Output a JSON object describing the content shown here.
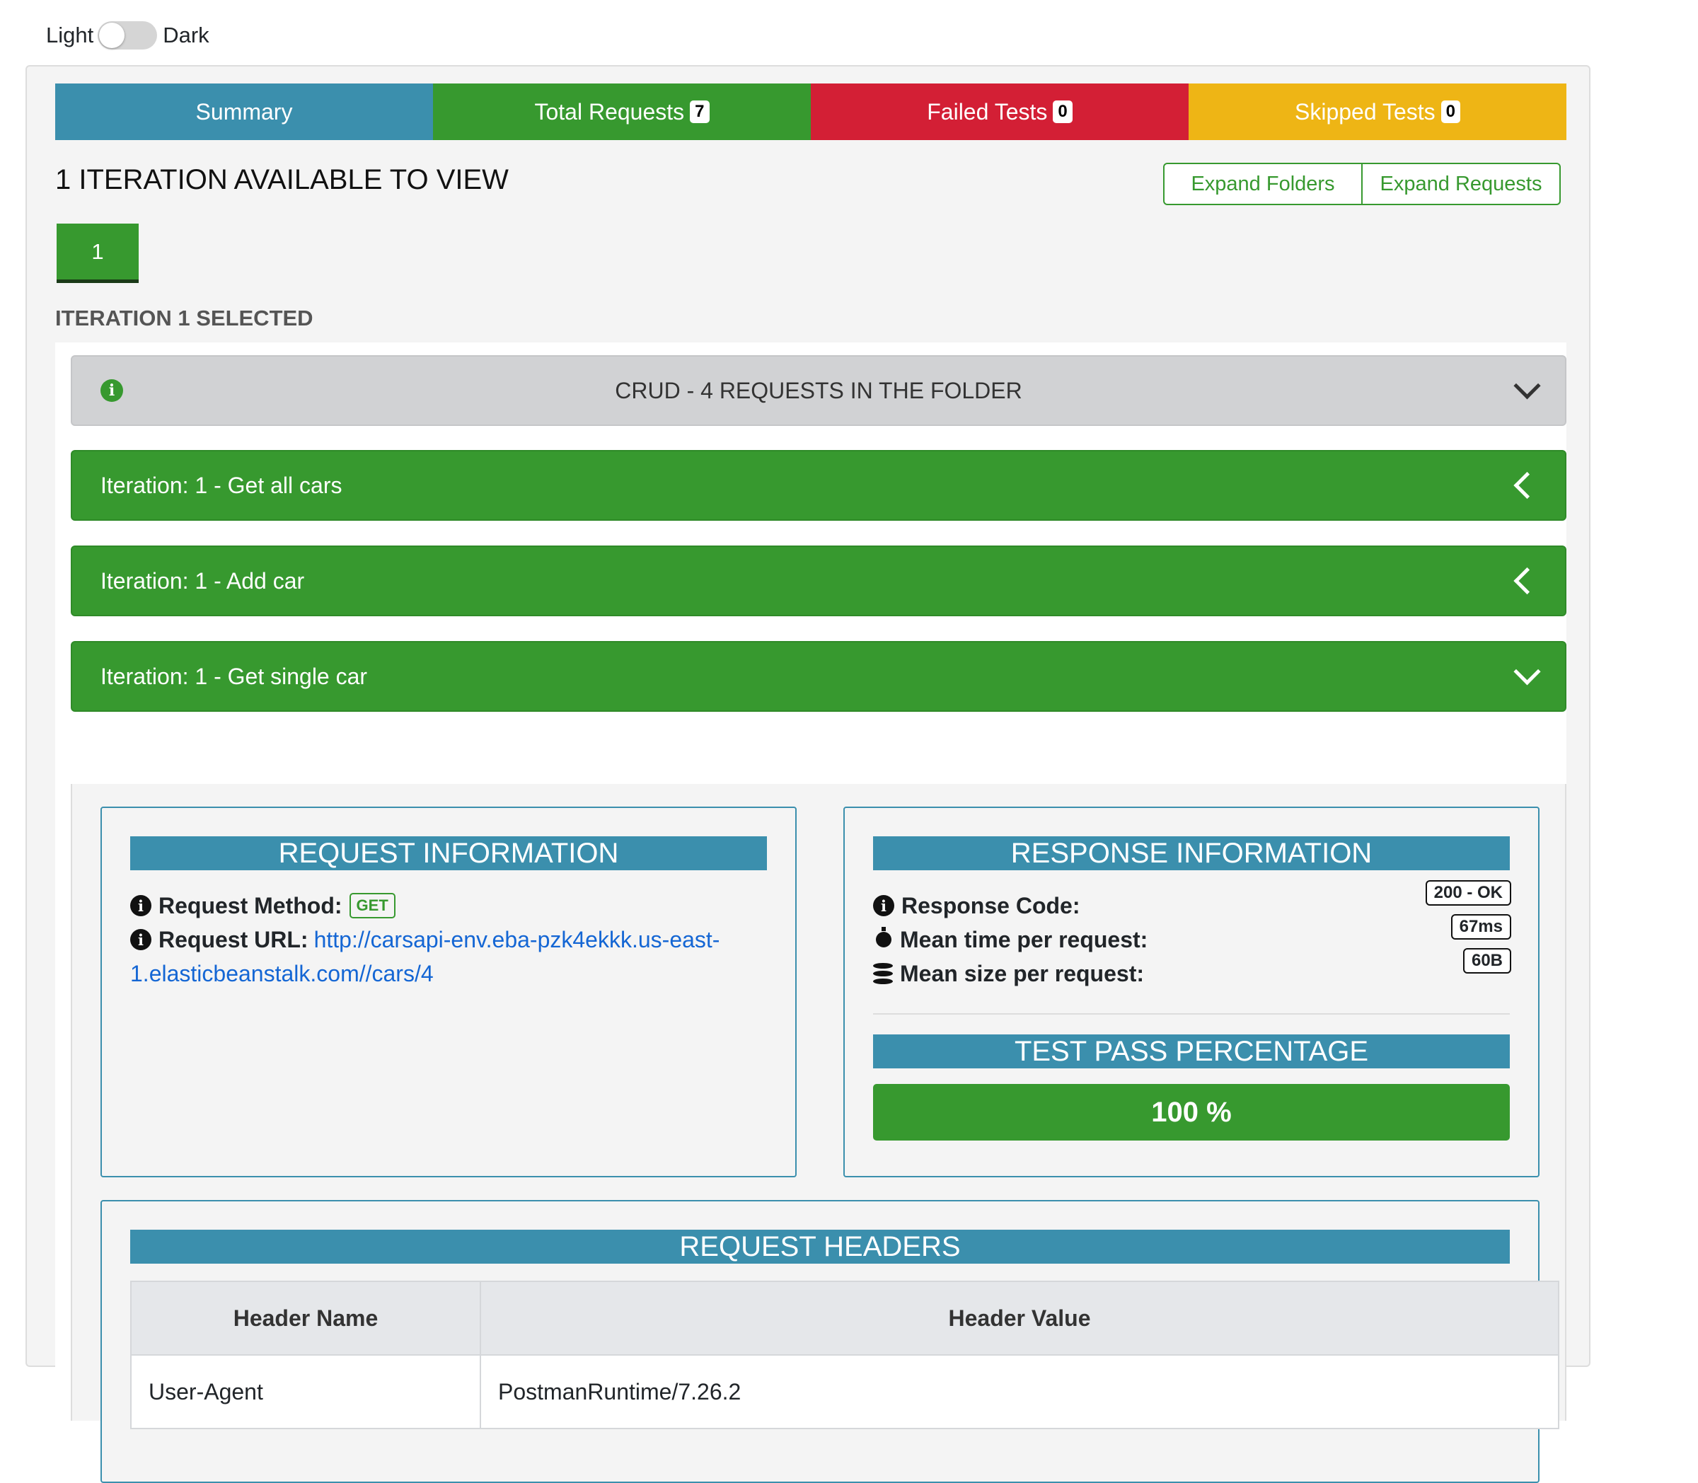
{
  "theme": {
    "light_label": "Light",
    "dark_label": "Dark"
  },
  "tabs": {
    "summary": "Summary",
    "total_requests": {
      "label": "Total Requests",
      "count": "7"
    },
    "failed_tests": {
      "label": "Failed Tests",
      "count": "0"
    },
    "skipped_tests": {
      "label": "Skipped Tests",
      "count": "0"
    }
  },
  "iteration": {
    "available_title": "1 ITERATION AVAILABLE TO VIEW",
    "expand_folders": "Expand Folders",
    "expand_requests": "Expand Requests",
    "button": "1",
    "selected_label": "ITERATION 1 SELECTED"
  },
  "folder": {
    "info_glyph": "i",
    "title": "CRUD - 4 REQUESTS IN THE FOLDER"
  },
  "requests": [
    {
      "title": "Iteration: 1 - Get all cars",
      "state": "collapsed"
    },
    {
      "title": "Iteration: 1 - Add car",
      "state": "collapsed"
    },
    {
      "title": "Iteration: 1 - Get single car",
      "state": "expanded"
    }
  ],
  "request_info": {
    "heading": "REQUEST INFORMATION",
    "method_label": "Request Method:",
    "method": "GET",
    "url_label": "Request URL:",
    "url_line1": "http://carsapi-env.eba-pzk4ekkk.us-east-",
    "url_line2": "1.elasticbeanstalk.com//cars/4"
  },
  "response_info": {
    "heading": "RESPONSE INFORMATION",
    "code_label": "Response Code:",
    "code": "200 - OK",
    "time_label": "Mean time per request:",
    "time": "67ms",
    "size_label": "Mean size per request:",
    "size": "60B"
  },
  "test_pass": {
    "heading": "TEST PASS PERCENTAGE",
    "value": "100 %",
    "percent": 100
  },
  "request_headers": {
    "heading": "REQUEST HEADERS",
    "columns": [
      "Header Name",
      "Header Value"
    ],
    "rows": [
      {
        "name": "User-Agent",
        "value": "PostmanRuntime/7.26.2"
      }
    ]
  },
  "colors": {
    "summary": "#3b8fad",
    "success": "#37992f",
    "danger": "#d31f35",
    "warning": "#eeb515",
    "link": "#1466d4"
  },
  "icons": {
    "info": "info-circle-icon",
    "stopwatch": "stopwatch-icon",
    "database": "database-icon",
    "chevron_down": "chevron-down-icon",
    "chevron_left": "chevron-left-icon"
  }
}
